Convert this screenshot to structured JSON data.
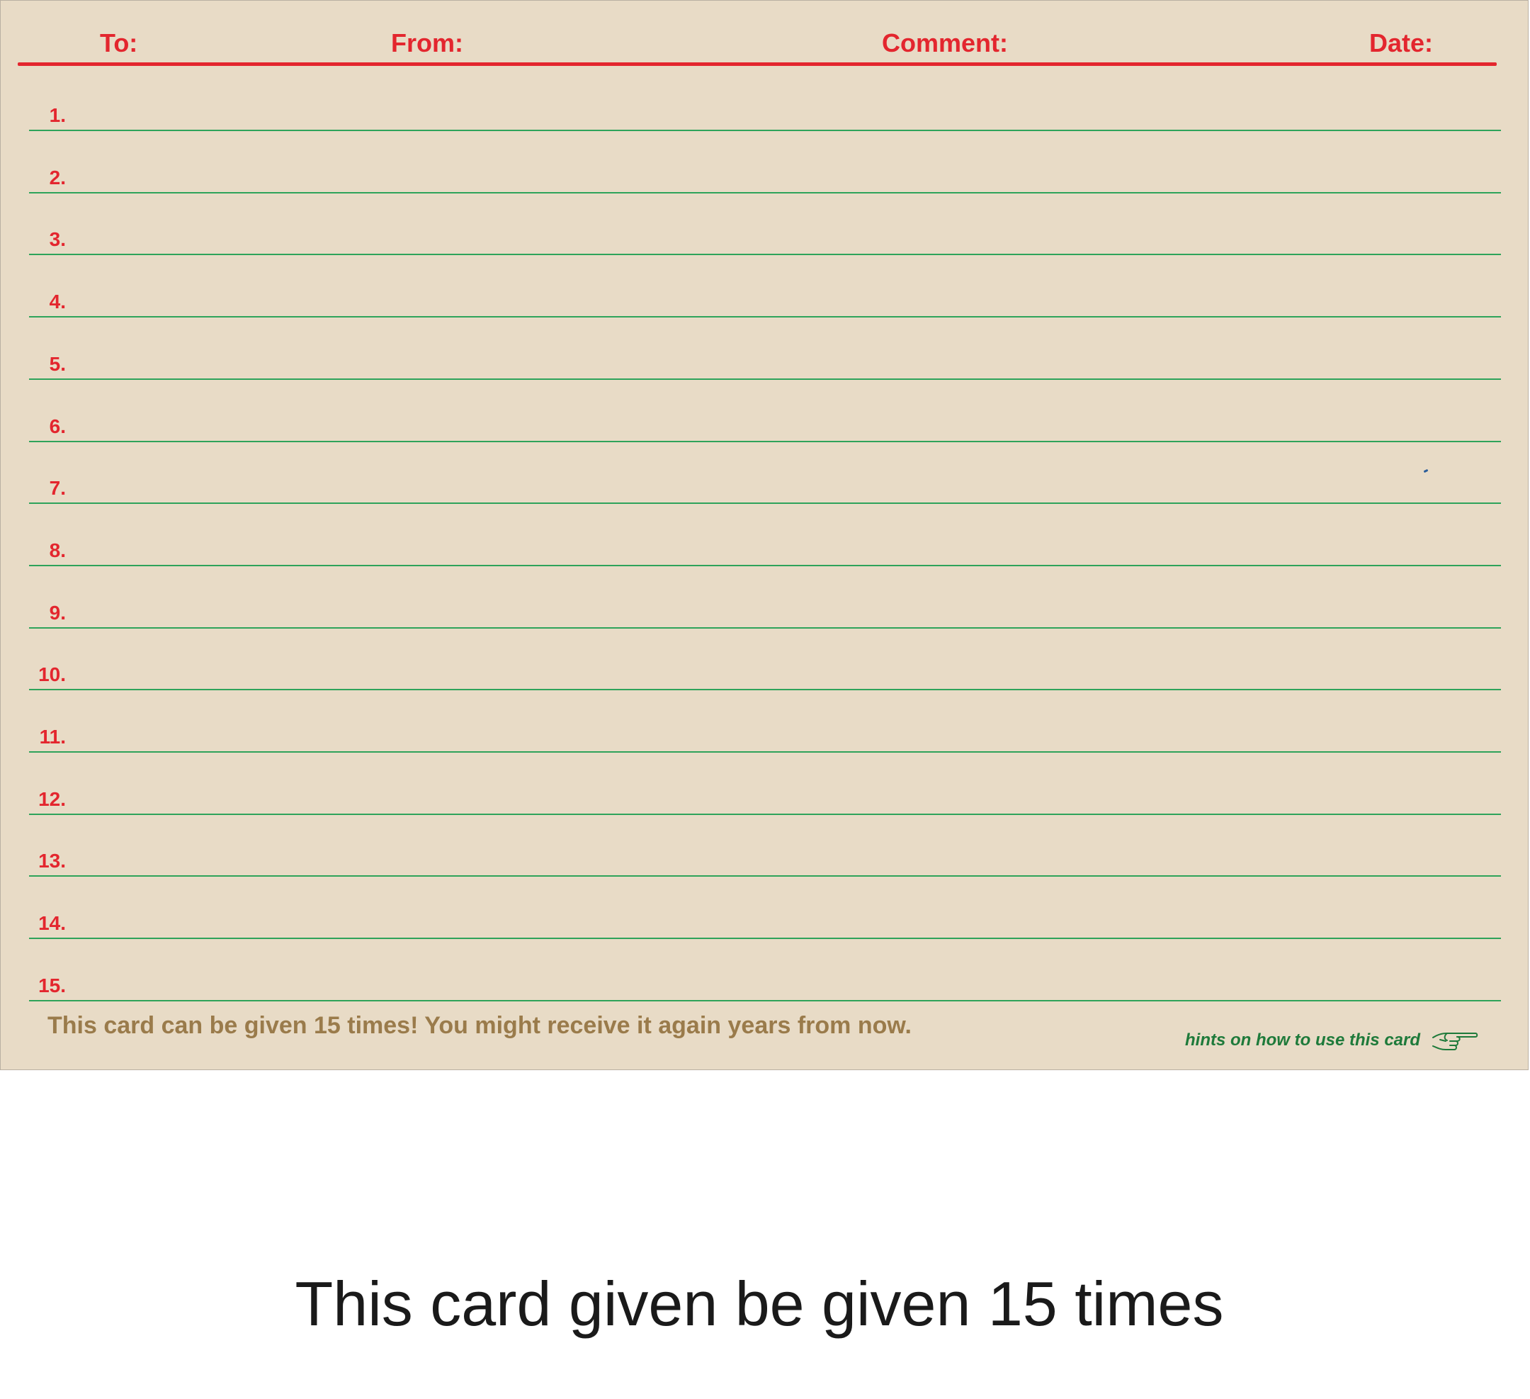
{
  "card": {
    "headers": {
      "to": "To:",
      "from": "From:",
      "comment": "Comment:",
      "date": "Date:"
    },
    "rows": [
      "1.",
      "2.",
      "3.",
      "4.",
      "5.",
      "6.",
      "7.",
      "8.",
      "9.",
      "10.",
      "11.",
      "12.",
      "13.",
      "14.",
      "15."
    ],
    "footer_note": "This card can be given 15 times! You might receive it again years from now.",
    "hints_link": "hints on how to  use this card",
    "hints_icon": "pointing-hand-icon"
  },
  "caption": "This card given be given 15 times",
  "colors": {
    "card_background": "#e8dbc6",
    "header_red": "#e3262e",
    "line_green": "#2ea35a",
    "footer_brown": "#9a7b4b",
    "hint_green": "#1e7a3a"
  }
}
